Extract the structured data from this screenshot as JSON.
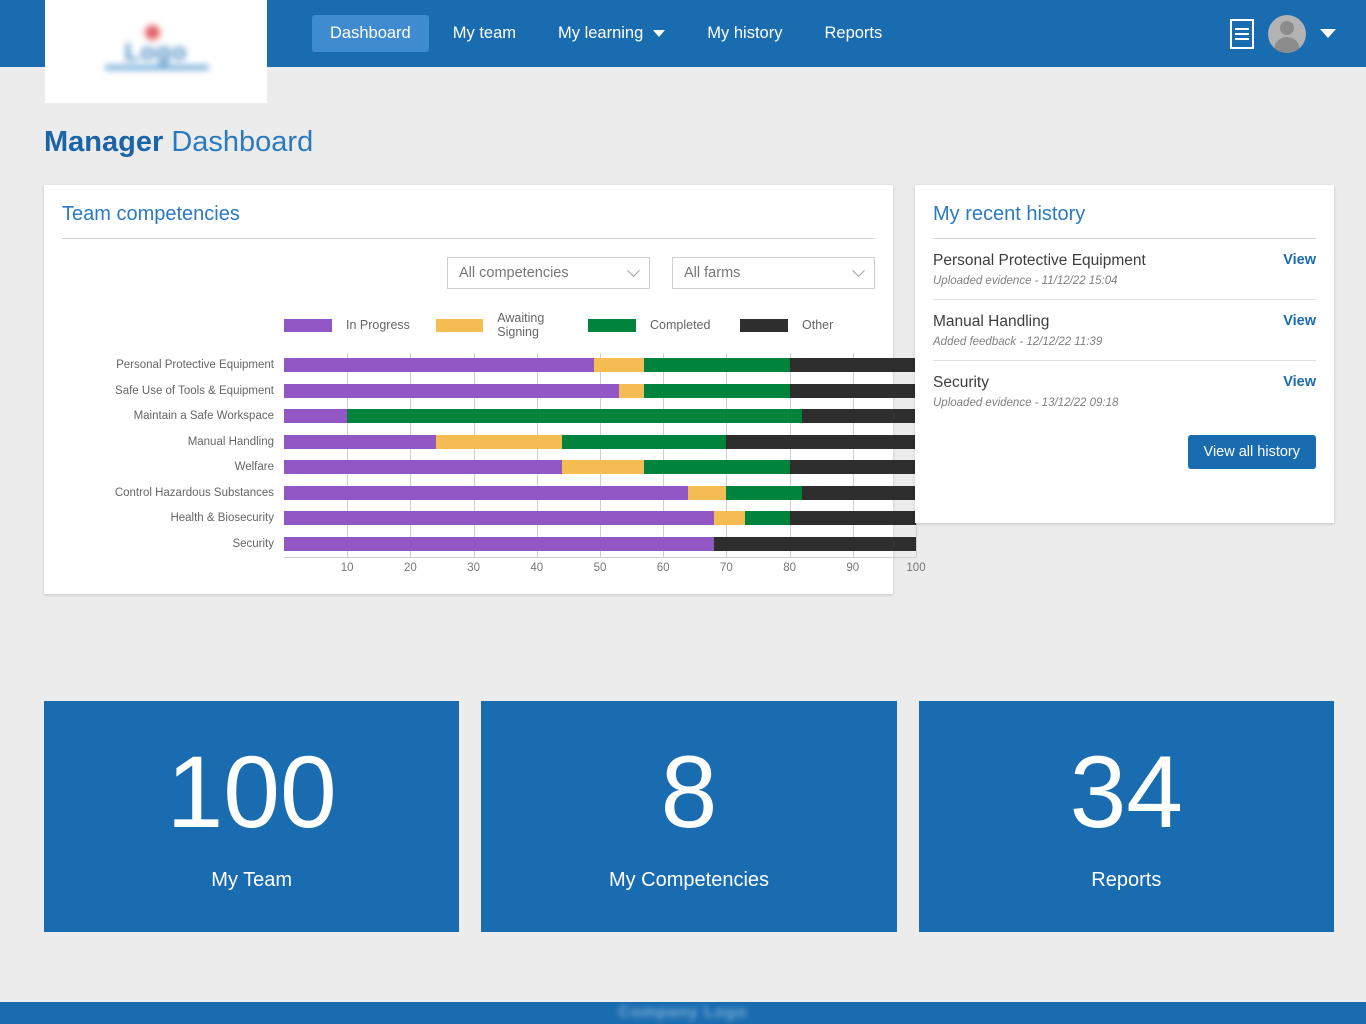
{
  "nav": {
    "items": [
      {
        "label": "Dashboard",
        "active": true,
        "caret": false
      },
      {
        "label": "My team",
        "active": false,
        "caret": false
      },
      {
        "label": "My learning",
        "active": false,
        "caret": true
      },
      {
        "label": "My history",
        "active": false,
        "caret": false
      },
      {
        "label": "Reports",
        "active": false,
        "caret": false
      }
    ],
    "menu_icon": "hamburger-menu-icon",
    "avatar_icon": "user-avatar-icon",
    "avatar_caret_icon": "chevron-down-icon"
  },
  "page": {
    "title_bold": "Manager",
    "title_rest": " Dashboard",
    "accent": "#1a6cb0"
  },
  "chart_card": {
    "title": "Team competencies",
    "filters": [
      {
        "name": "competency-filter",
        "value": "All competencies"
      },
      {
        "name": "farm-filter",
        "value": "All farms"
      }
    ]
  },
  "chart_data": {
    "type": "bar",
    "orientation": "horizontal",
    "stacked": true,
    "title": "Team competencies",
    "xlabel": "",
    "ylabel": "",
    "xlim": [
      0,
      100
    ],
    "xticks": [
      10,
      20,
      30,
      40,
      50,
      60,
      70,
      80,
      90,
      100
    ],
    "grid": true,
    "legend_position": "top",
    "categories": [
      "Personal Protective Equipment",
      "Safe Use of Tools & Equipment",
      "Maintain a Safe Workspace",
      "Manual Handling",
      "Welfare",
      "Control Hazardous Substances",
      "Health & Biosecurity",
      "Security"
    ],
    "series": [
      {
        "name": "In Progress",
        "color": "#9257c4",
        "values": [
          49,
          53,
          10,
          24,
          44,
          64,
          68,
          68
        ]
      },
      {
        "name": "Awaiting Signing",
        "color": "#f5bc54",
        "values": [
          8,
          4,
          0,
          20,
          13,
          6,
          5,
          0
        ]
      },
      {
        "name": "Completed",
        "color": "#00843d",
        "values": [
          23,
          23,
          72,
          26,
          23,
          12,
          7,
          0
        ]
      },
      {
        "name": "Other",
        "color": "#2e2e2e",
        "values": [
          20,
          20,
          18,
          30,
          20,
          18,
          20,
          32
        ]
      }
    ]
  },
  "history_card": {
    "title": "My recent history",
    "items": [
      {
        "name": "Personal Protective Equipment",
        "detail": "Uploaded evidence - 11/12/22 15:04",
        "action": "View"
      },
      {
        "name": "Manual Handling",
        "detail": "Added feedback - 12/12/22 11:39",
        "action": "View"
      },
      {
        "name": "Security",
        "detail": "Uploaded evidence - 13/12/22 09:18",
        "action": "View"
      }
    ],
    "button": "View all history"
  },
  "tiles": [
    {
      "value": "100",
      "label": "My Team"
    },
    {
      "value": "8",
      "label": "My Competencies"
    },
    {
      "value": "34",
      "label": "Reports"
    }
  ],
  "footer": {
    "text": "Company Logo"
  }
}
